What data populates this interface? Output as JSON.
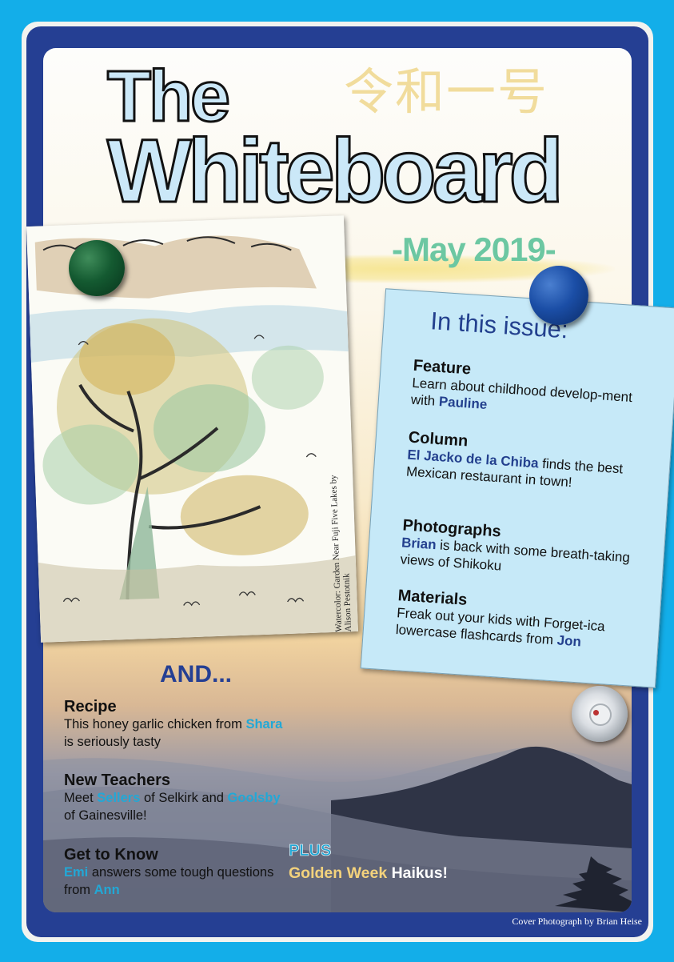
{
  "masthead": {
    "title_line1": "The",
    "title_line2": "Whiteboard",
    "kanji": "令和一号",
    "issue_date": "-May 2019-"
  },
  "painting": {
    "credit": "Watercolor: Garden Near Fuji Five Lakes by Alison Pestotnik"
  },
  "contents": {
    "heading": "In this issue:",
    "items": [
      {
        "section": "Feature",
        "pre": "Learn about childhood develop-ment with ",
        "name": "Pauline",
        "post": ""
      },
      {
        "section": "Column",
        "pre": "",
        "name": "El Jacko de la Chiba",
        "post": " finds the best Mexican restaurant in town!"
      },
      {
        "section": "Photographs",
        "pre": "",
        "name": "Brian",
        "post": " is back with some breath-taking views of Shikoku"
      },
      {
        "section": "Materials",
        "pre": "Freak out your kids with Forget-ica lowercase flashcards from ",
        "name": "Jon",
        "post": ""
      }
    ]
  },
  "also": {
    "heading": "AND...",
    "recipe": {
      "title": "Recipe",
      "pre": "This honey garlic chicken from ",
      "name": "Shara",
      "post": " is seriously tasty"
    },
    "new_teachers": {
      "title": "New Teachers",
      "pre": "Meet ",
      "name1": "Sellers",
      "mid": " of Selkirk and ",
      "name2": "Goolsby",
      "post": " of Gainesville!"
    },
    "get_to_know": {
      "title": "Get to Know",
      "name1": "Emi",
      "mid": " answers some tough questions from ",
      "name2": "Ann"
    },
    "plus": {
      "label": "PLUS",
      "highlight": "Golden Week",
      "rest": " Haikus!"
    }
  },
  "footer": {
    "credit": "Cover Photograph by Brian Heise"
  },
  "colors": {
    "frame": "#253f93",
    "background": "#13aee9",
    "accent_cyan": "#22a8d6",
    "title_fill": "#cbe8f8",
    "date_green": "#6cc7a2"
  }
}
